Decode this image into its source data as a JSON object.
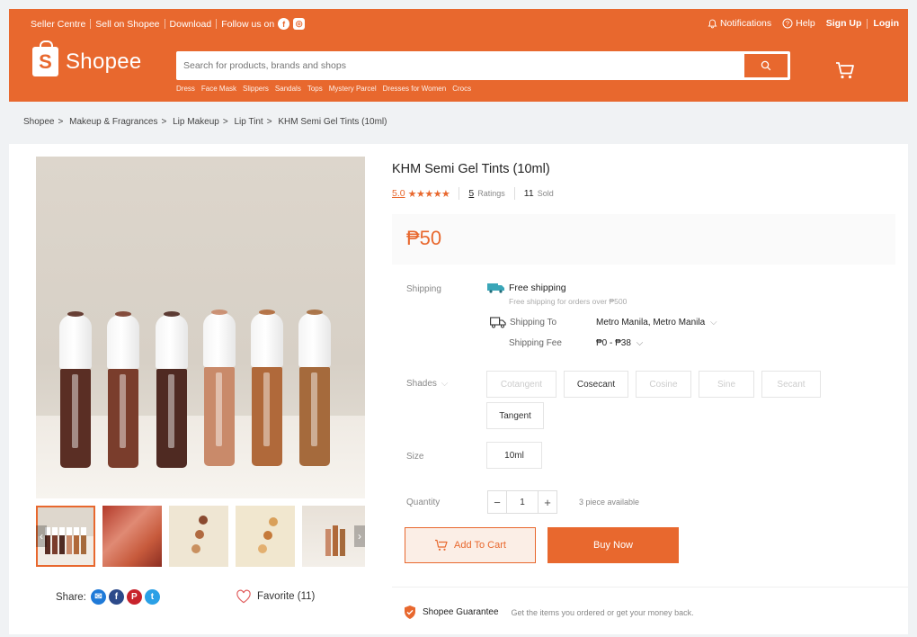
{
  "colors": {
    "brand": "#e8682e",
    "background": "#f0f2f4"
  },
  "topbar": {
    "seller_centre": "Seller Centre",
    "sell_on_shopee": "Sell on Shopee",
    "download": "Download",
    "follow_us": "Follow us on",
    "notifications": "Notifications",
    "help": "Help",
    "sign_up": "Sign Up",
    "login": "Login"
  },
  "header": {
    "logo_text": "Shopee",
    "logo_letter": "S",
    "search_placeholder": "Search for products, brands and shops",
    "keywords": [
      "Dress",
      "Face Mask",
      "Slippers",
      "Sandals",
      "Tops",
      "Mystery Parcel",
      "Dresses for Women",
      "Crocs"
    ]
  },
  "breadcrumb": [
    "Shopee",
    "Makeup & Fragrances",
    "Lip Makeup",
    "Lip Tint",
    "KHM Semi Gel Tints (10ml)"
  ],
  "product": {
    "title": "KHM Semi Gel Tints (10ml)",
    "rating": "5.0",
    "stars": "★★★★★",
    "ratings_count": "5",
    "ratings_label": "Ratings",
    "sold_count": "11",
    "sold_label": "Sold",
    "price": "₱50"
  },
  "shipping": {
    "label": "Shipping",
    "free_shipping": "Free shipping",
    "free_shipping_sub": "Free shipping for orders over ₱500",
    "ship_to_label": "Shipping To",
    "ship_to_value": "Metro Manila, Metro Manila",
    "fee_label": "Shipping Fee",
    "fee_value": "₱0 - ₱38"
  },
  "shades": {
    "label": "Shades",
    "options": [
      {
        "name": "Cotangent",
        "available": false
      },
      {
        "name": "Cosecant",
        "available": true
      },
      {
        "name": "Cosine",
        "available": false
      },
      {
        "name": "Sine",
        "available": false
      },
      {
        "name": "Secant",
        "available": false
      },
      {
        "name": "Tangent",
        "available": true
      }
    ]
  },
  "size": {
    "label": "Size",
    "option": "10ml"
  },
  "quantity": {
    "label": "Quantity",
    "minus": "−",
    "value": "1",
    "plus": "+",
    "available": "3 piece available"
  },
  "actions": {
    "add_to_cart": "Add To Cart",
    "buy_now": "Buy Now"
  },
  "share": {
    "label": "Share:",
    "favorite": "Favorite (11)"
  },
  "guarantee": {
    "title": "Shopee Guarantee",
    "subtitle": "Get the items you ordered or get your money back."
  },
  "bottle_tints": [
    "#5a2e24",
    "#7a3d2c",
    "#4f2a22",
    "#c98a6a",
    "#b0693a",
    "#a56a3c"
  ]
}
